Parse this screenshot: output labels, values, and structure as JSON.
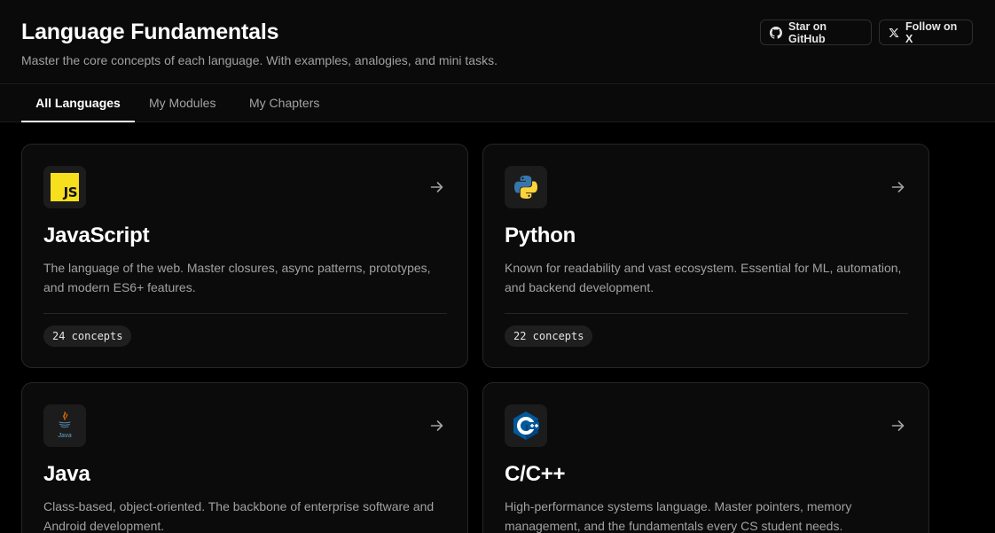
{
  "header": {
    "title": "Language Fundamentals",
    "subtitle": "Master the core concepts of each language. With examples, analogies, and mini tasks.",
    "github_button": "Star on GitHub",
    "x_button": "Follow on X"
  },
  "tabs": [
    {
      "label": "All Languages",
      "active": true
    },
    {
      "label": "My Modules",
      "active": false
    },
    {
      "label": "My Chapters",
      "active": false
    }
  ],
  "cards": [
    {
      "name": "JavaScript",
      "icon": "javascript-logo-icon",
      "logo_text": "JS",
      "description": "The language of the web. Master closures, async patterns, prototypes, and modern ES6+ features.",
      "badge": "24 concepts"
    },
    {
      "name": "Python",
      "icon": "python-logo-icon",
      "description": "Known for readability and vast ecosystem. Essential for ML, automation, and backend development.",
      "badge": "22 concepts"
    },
    {
      "name": "Java",
      "icon": "java-logo-icon",
      "logo_text": "Java",
      "description": "Class-based, object-oriented. The backbone of enterprise software and Android development."
    },
    {
      "name": "C/C++",
      "icon": "cpp-logo-icon",
      "description": "High-performance systems language. Master pointers, memory management, and the fundamentals every CS student needs."
    }
  ],
  "colors": {
    "background": "#000000",
    "card": "#0b0b0b",
    "accent_js": "#f7df1e",
    "python_blue": "#3776ab",
    "python_yellow": "#ffd43b",
    "cpp_blue": "#00599c"
  }
}
